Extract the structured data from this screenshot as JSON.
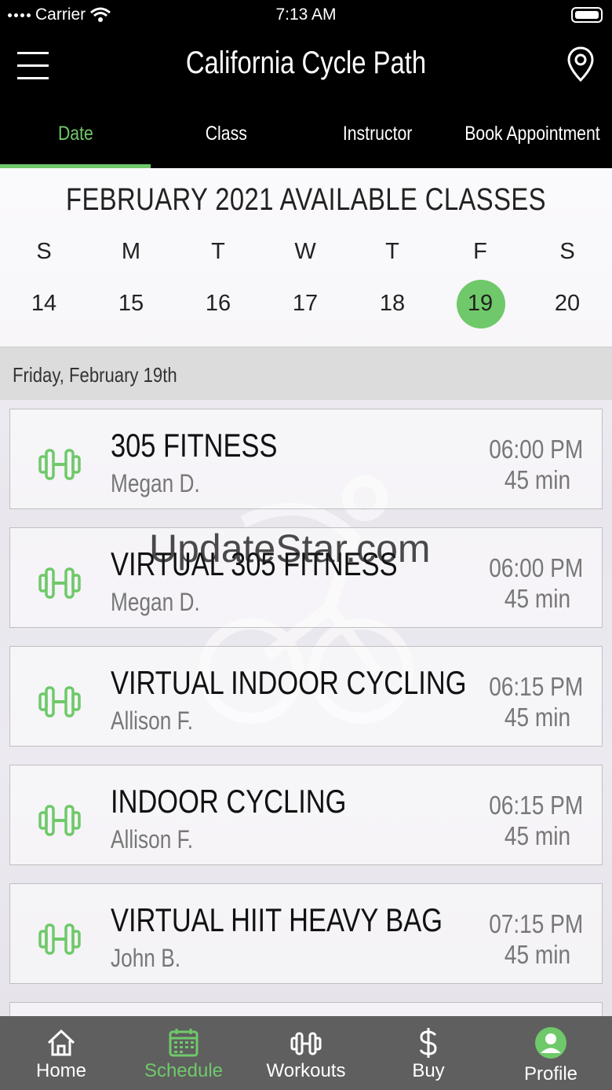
{
  "status_bar": {
    "carrier": "Carrier",
    "time": "7:13 AM"
  },
  "header": {
    "title": "California Cycle Path"
  },
  "tabs": [
    {
      "label": "Date",
      "active": true
    },
    {
      "label": "Class",
      "active": false
    },
    {
      "label": "Instructor",
      "active": false
    },
    {
      "label": "Book Appointment",
      "active": false
    }
  ],
  "calendar": {
    "title": "FEBRUARY 2021 AVAILABLE CLASSES",
    "day_names": [
      "S",
      "M",
      "T",
      "W",
      "T",
      "F",
      "S"
    ],
    "day_numbers": [
      "14",
      "15",
      "16",
      "17",
      "18",
      "19",
      "20"
    ],
    "selected_day": "19"
  },
  "selected_date_label": "Friday, February 19th",
  "classes": [
    {
      "name": "305 FITNESS",
      "instructor": "Megan D.",
      "time": "06:00 PM",
      "duration": "45 min"
    },
    {
      "name": "VIRTUAL 305 FITNESS",
      "instructor": "Megan D.",
      "time": "06:00 PM",
      "duration": "45 min"
    },
    {
      "name": "VIRTUAL INDOOR CYCLING",
      "instructor": "Allison F.",
      "time": "06:15 PM",
      "duration": "45 min"
    },
    {
      "name": "INDOOR CYCLING",
      "instructor": "Allison F.",
      "time": "06:15 PM",
      "duration": "45 min"
    },
    {
      "name": "VIRTUAL  HIIT HEAVY BAG",
      "instructor": "John B.",
      "time": "07:15 PM",
      "duration": "45 min"
    }
  ],
  "watermark": "UpdateStar.com",
  "bottom_nav": [
    {
      "label": "Home",
      "icon": "home-icon"
    },
    {
      "label": "Schedule",
      "icon": "calendar-icon",
      "active": true
    },
    {
      "label": "Workouts",
      "icon": "dumbbell-icon"
    },
    {
      "label": "Buy",
      "icon": "dollar-icon"
    },
    {
      "label": "Profile",
      "icon": "profile-icon"
    }
  ],
  "colors": {
    "accent": "#6fc96a",
    "header_bg": "#000000",
    "nav_bg": "#5f5f5f"
  }
}
